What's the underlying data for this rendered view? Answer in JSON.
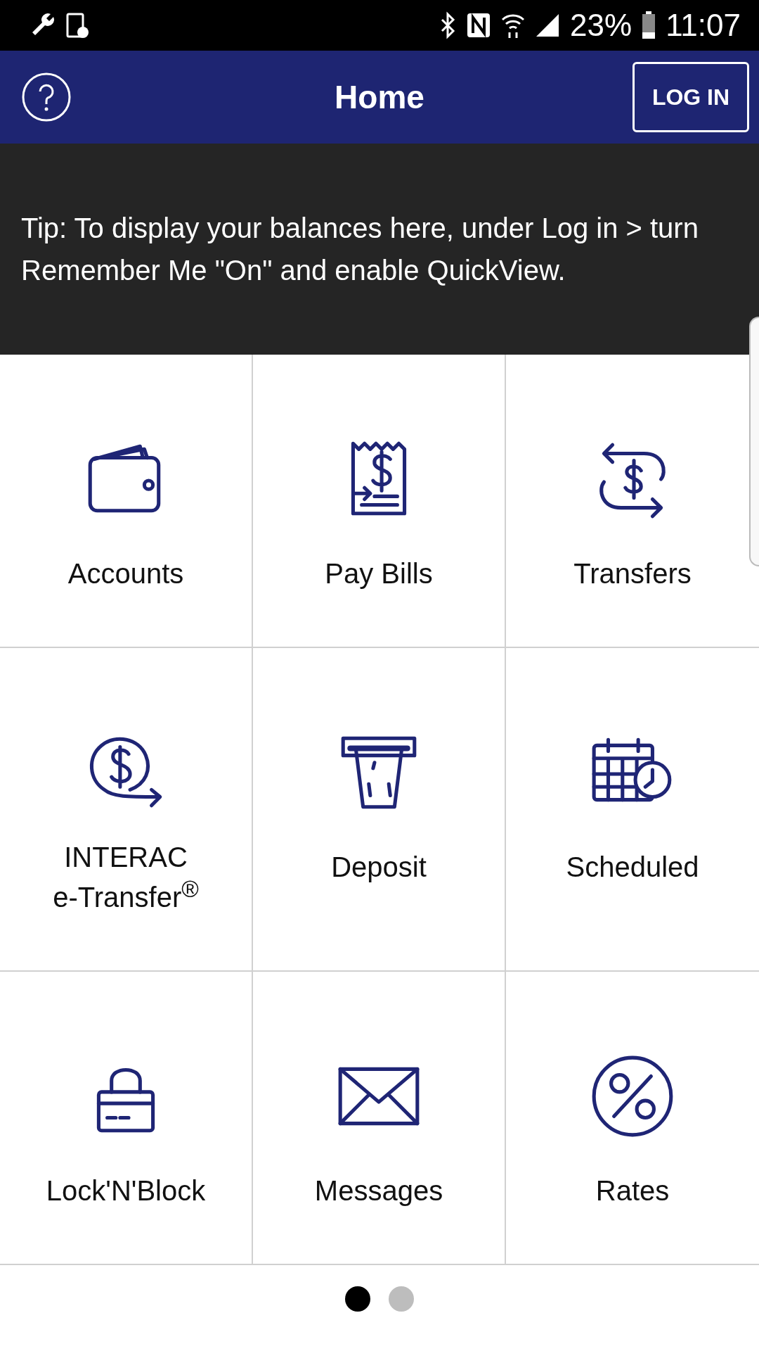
{
  "status_bar": {
    "battery": "23%",
    "time": "11:07"
  },
  "header": {
    "title": "Home",
    "login_button": "LOG IN"
  },
  "tip": "Tip: To display your balances here, under Log in > turn Remember Me \"On\" and enable QuickView.",
  "tiles": [
    {
      "kind": "wallet",
      "label": "Accounts"
    },
    {
      "kind": "bill",
      "label": "Pay Bills"
    },
    {
      "kind": "transfer",
      "label": "Transfers"
    },
    {
      "kind": "etransfer",
      "label": "INTERAC\ne-Transfer$^{®}$"
    },
    {
      "kind": "deposit",
      "label": "Deposit"
    },
    {
      "kind": "calendar",
      "label": "Scheduled"
    },
    {
      "kind": "lock",
      "label": "Lock'N'Block"
    },
    {
      "kind": "mail",
      "label": "Messages"
    },
    {
      "kind": "percent",
      "label": "Rates"
    }
  ],
  "pager": [
    {
      "selected": true
    },
    {
      "selected": false
    }
  ]
}
